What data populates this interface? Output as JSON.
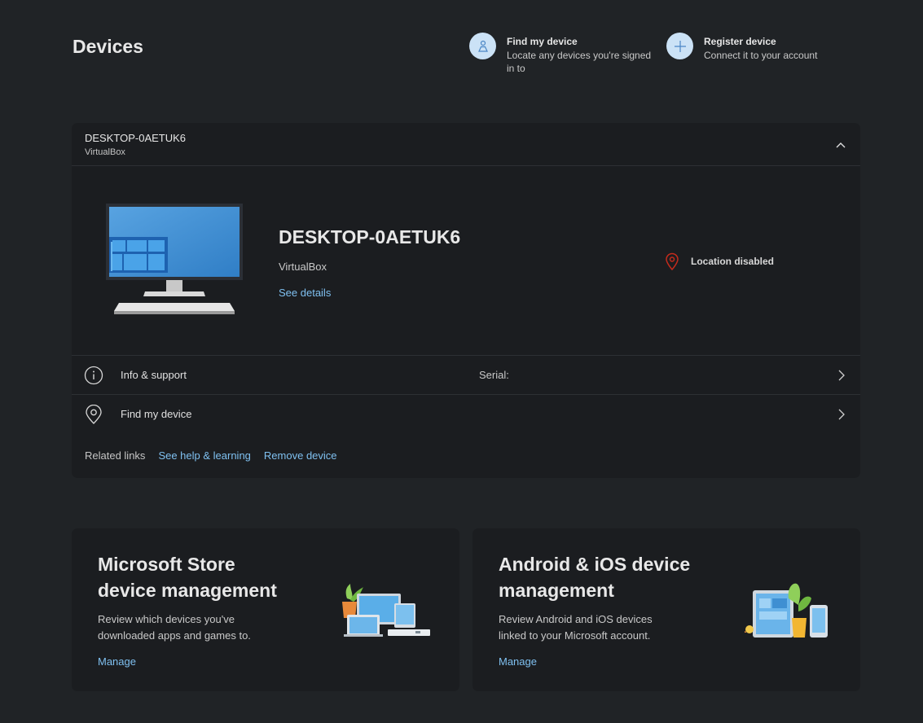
{
  "page": {
    "title": "Devices"
  },
  "quick_actions": {
    "find": {
      "title": "Find my device",
      "desc_line1": "Locate any devices you're signed",
      "desc_line2": "in to"
    },
    "register": {
      "title": "Register device",
      "desc": "Connect it to your account"
    }
  },
  "device": {
    "header_name": "DESKTOP-0AETUK6",
    "header_sub": "VirtualBox",
    "name": "DESKTOP-0AETUK6",
    "model": "VirtualBox",
    "see_details": "See details",
    "location_status": "Location disabled",
    "rows": {
      "info": {
        "label": "Info & support",
        "serial": "Serial:"
      },
      "find": {
        "label": "Find my device"
      }
    },
    "related": {
      "label": "Related links",
      "help": "See help & learning",
      "remove": "Remove device"
    }
  },
  "promos": {
    "store": {
      "title_line1": "Microsoft Store",
      "title_line2": "device management",
      "desc_line1": "Review which devices you've",
      "desc_line2": "downloaded apps and games to.",
      "link": "Manage"
    },
    "mobile": {
      "title_line1": "Android & iOS device",
      "title_line2": "management",
      "desc_line1": "Review Android and iOS devices",
      "desc_line2": "linked to your Microsoft account.",
      "link": "Manage"
    }
  },
  "colors": {
    "background": "#202326",
    "card": "#1b1d20",
    "link": "#7fc0f0",
    "location_icon": "#c42b1c",
    "action_circle": "#cbe2f6"
  },
  "icons": {
    "find_action": "location-person-icon",
    "register_action": "plus-icon",
    "collapse": "chevron-up-icon",
    "location": "location-pin-icon",
    "info": "info-icon",
    "find": "location-pin-outline-icon",
    "row_chevron": "chevron-right-icon"
  }
}
